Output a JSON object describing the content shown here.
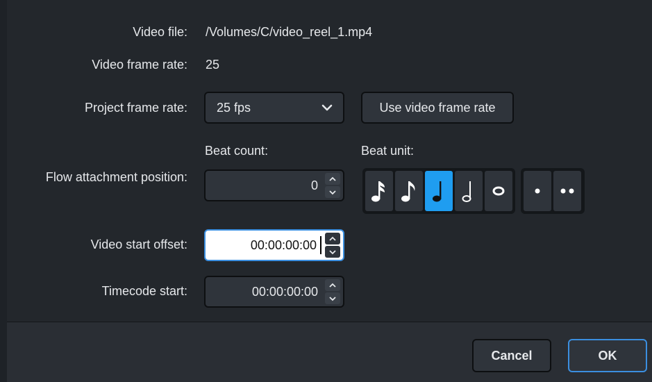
{
  "labels": {
    "video_file": "Video file:",
    "video_frame_rate": "Video frame rate:",
    "project_frame_rate": "Project frame rate:",
    "beat_count": "Beat count:",
    "beat_unit": "Beat unit:",
    "flow_attachment_position": "Flow attachment position:",
    "video_start_offset": "Video start offset:",
    "timecode_start": "Timecode start:"
  },
  "values": {
    "video_file": "/Volumes/C/video_reel_1.mp4",
    "video_frame_rate": "25",
    "project_frame_rate": "25 fps",
    "beat_count": "0",
    "video_start_offset": "00:00:00:00",
    "timecode_start": "00:00:00:00"
  },
  "buttons": {
    "use_video_frame_rate": "Use video frame rate",
    "cancel": "Cancel",
    "ok": "OK"
  },
  "beat_units": [
    "sixteenth-note",
    "eighth-note",
    "quarter-note",
    "half-note",
    "whole-note"
  ],
  "selected_beat_unit": "quarter-note",
  "dot_options": [
    "single-dot",
    "double-dot"
  ],
  "colors": {
    "accent": "#1f9df0",
    "focus_border": "#3b8fe0",
    "background": "#23272c"
  }
}
